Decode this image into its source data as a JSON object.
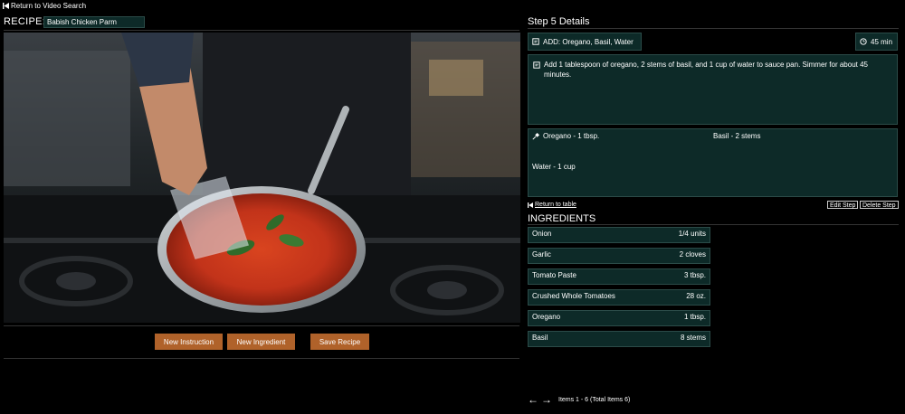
{
  "nav": {
    "return_video_search": "Return to Video Search"
  },
  "recipe": {
    "label": "RECIPE:",
    "name": "Babish Chicken Parm"
  },
  "buttons": {
    "new_instruction": "New Instruction",
    "new_ingredient": "New Ingredient",
    "save_recipe": "Save Recipe"
  },
  "step": {
    "title": "Step 5 Details",
    "action": "ADD: Oregano, Basil, Water",
    "time": "45 min",
    "description": "Add 1 tablespoon of oregano, 2 stems of basil, and 1 cup of water to sauce pan. Simmer for about 45 minutes.",
    "ingredients": [
      "Oregano - 1 tbsp.",
      "Basil - 2 stems",
      "Water - 1 cup"
    ],
    "return_to_table": "Return to table",
    "edit_step": "Edit Step",
    "delete_step": "Delete Step"
  },
  "ingredients": {
    "title": "INGREDIENTS",
    "rows": [
      {
        "name": "Onion",
        "qty": "1/4 units"
      },
      {
        "name": "Garlic",
        "qty": "2 cloves"
      },
      {
        "name": "Tomato Paste",
        "qty": "3 tbsp."
      },
      {
        "name": "Crushed Whole Tomatoes",
        "qty": "28 oz."
      },
      {
        "name": "Oregano",
        "qty": "1 tbsp."
      },
      {
        "name": "Basil",
        "qty": "8 stems"
      }
    ],
    "pager_text": "Items 1 - 6 (Total Items 6)"
  },
  "colors": {
    "panel_bg": "#0d2a28",
    "button_orange": "#b0622a",
    "sauce_red": "#c9361b"
  },
  "icons": {
    "back": "skip-back-icon",
    "add": "note-icon",
    "time": "clock-icon",
    "desc": "note-icon",
    "ingr": "pin-icon",
    "prev": "arrow-left-icon",
    "next": "arrow-right-icon"
  }
}
